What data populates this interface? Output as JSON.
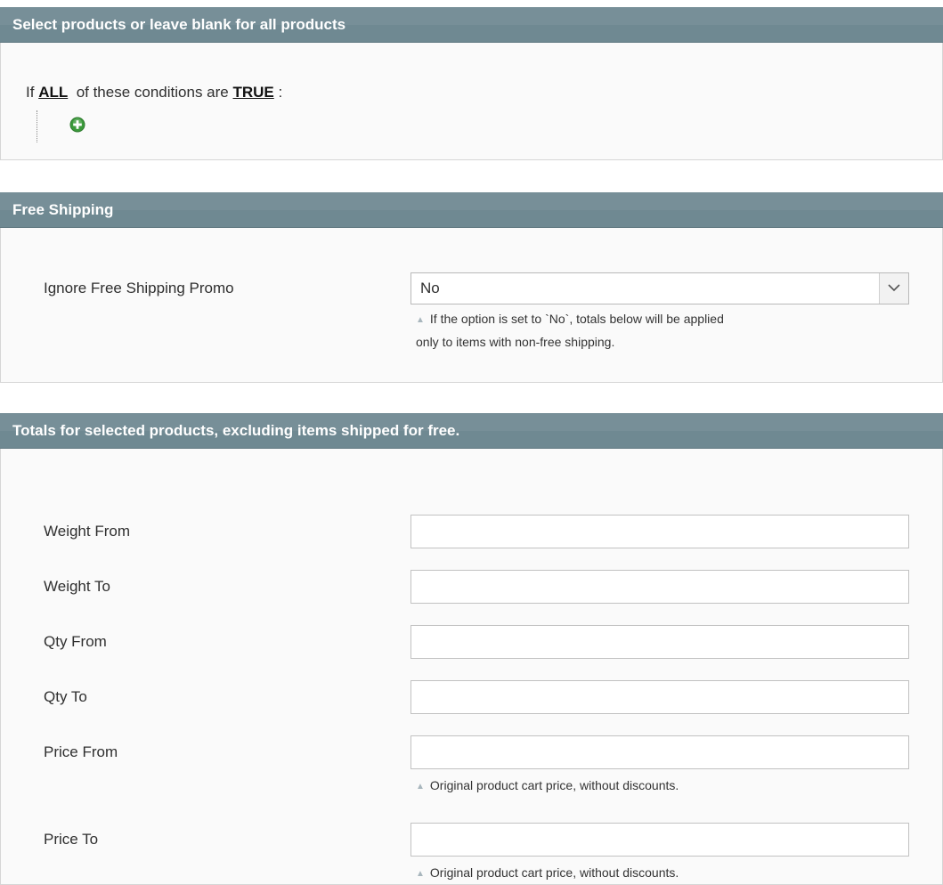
{
  "conditions_section": {
    "title": "Select products or leave blank for all products",
    "if_text": "If",
    "aggregator": "ALL",
    "middle_text": "of these conditions are",
    "value": "TRUE",
    "colon": ":",
    "add_icon": "add-condition-icon"
  },
  "free_shipping_section": {
    "title": "Free Shipping",
    "ignore_label": "Ignore Free Shipping Promo",
    "ignore_value": "No",
    "note_line1": "If the option is set to `No`, totals below will be applied",
    "note_line2": "only to items with non-free shipping."
  },
  "totals_section": {
    "title": "Totals for selected products, excluding items shipped for free.",
    "fields": [
      {
        "label": "Weight From",
        "value": ""
      },
      {
        "label": "Weight To",
        "value": ""
      },
      {
        "label": "Qty From",
        "value": ""
      },
      {
        "label": "Qty To",
        "value": ""
      },
      {
        "label": "Price From",
        "value": "",
        "note": "Original product cart price, without discounts."
      },
      {
        "label": "Price To",
        "value": "",
        "note": "Original product cart price, without discounts."
      }
    ]
  },
  "colors": {
    "header_bg": "#6f8992",
    "header_text": "#ffffff",
    "panel_bg": "#fafafa",
    "add_icon_green": "#3b9a3b"
  }
}
